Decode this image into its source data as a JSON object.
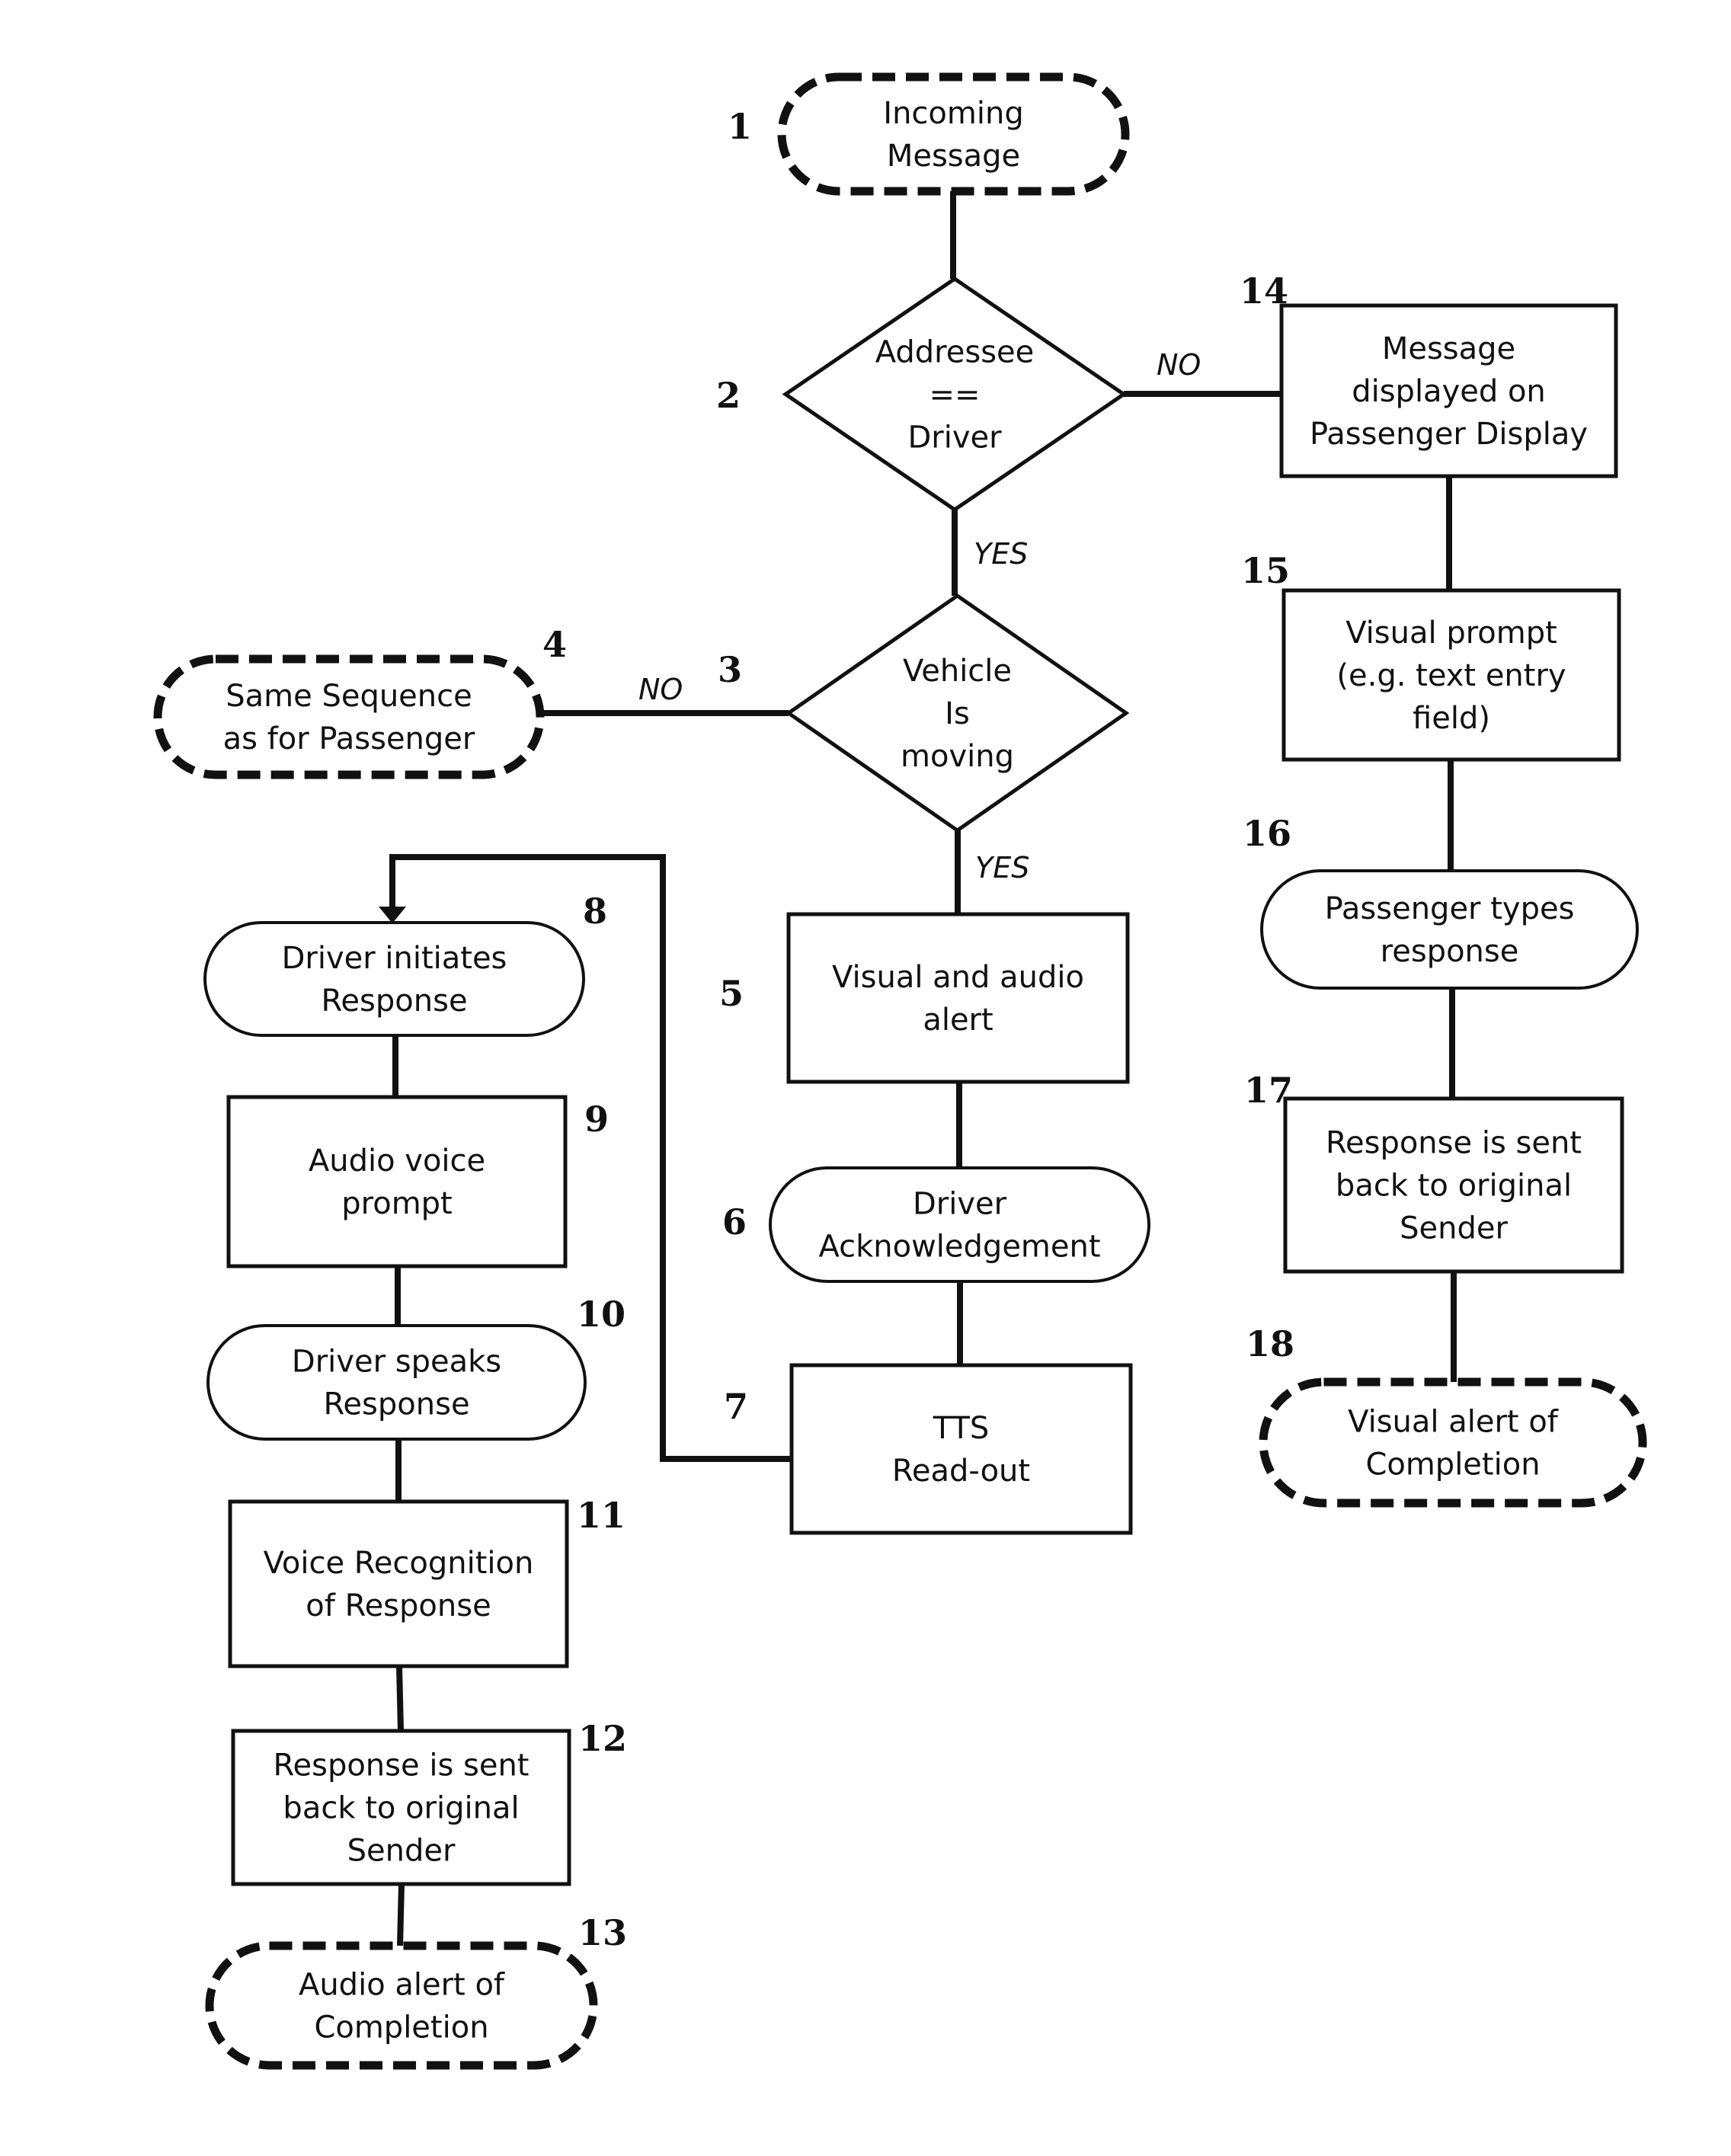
{
  "diagram": {
    "type": "flowchart",
    "nodes": [
      {
        "id": "1",
        "shape": "terminal-dashed",
        "lines": [
          "Incoming",
          "Message"
        ]
      },
      {
        "id": "2",
        "shape": "decision",
        "lines": [
          "Addressee",
          "==",
          "Driver"
        ]
      },
      {
        "id": "3",
        "shape": "decision",
        "lines": [
          "Vehicle",
          "Is",
          "moving"
        ]
      },
      {
        "id": "4",
        "shape": "terminal-dashed",
        "lines": [
          "Same Sequence",
          "as for Passenger"
        ]
      },
      {
        "id": "5",
        "shape": "process",
        "lines": [
          "Visual and audio",
          "alert"
        ]
      },
      {
        "id": "6",
        "shape": "terminal",
        "lines": [
          "Driver",
          "Acknowledgement"
        ]
      },
      {
        "id": "7",
        "shape": "process",
        "lines": [
          "TTS",
          "Read-out"
        ]
      },
      {
        "id": "8",
        "shape": "terminal",
        "lines": [
          "Driver initiates",
          "Response"
        ]
      },
      {
        "id": "9",
        "shape": "process",
        "lines": [
          "Audio voice",
          "prompt"
        ]
      },
      {
        "id": "10",
        "shape": "terminal",
        "lines": [
          "Driver speaks",
          "Response"
        ]
      },
      {
        "id": "11",
        "shape": "process",
        "lines": [
          "Voice Recognition",
          "of Response"
        ]
      },
      {
        "id": "12",
        "shape": "process",
        "lines": [
          "Response is sent",
          "back to original",
          "Sender"
        ]
      },
      {
        "id": "13",
        "shape": "terminal-dashed",
        "lines": [
          "Audio alert of",
          "Completion"
        ]
      },
      {
        "id": "14",
        "shape": "process",
        "lines": [
          "Message",
          "displayed on",
          "Passenger Display"
        ]
      },
      {
        "id": "15",
        "shape": "process",
        "lines": [
          "Visual prompt",
          "(e.g. text entry",
          "field)"
        ]
      },
      {
        "id": "16",
        "shape": "terminal",
        "lines": [
          "Passenger  types",
          "response"
        ]
      },
      {
        "id": "17",
        "shape": "process",
        "lines": [
          "Response is sent",
          "back to original",
          "Sender"
        ]
      },
      {
        "id": "18",
        "shape": "terminal-dashed",
        "lines": [
          "Visual alert of",
          "Completion"
        ]
      }
    ],
    "edges": [
      {
        "from": "1",
        "to": "2",
        "label": ""
      },
      {
        "from": "2",
        "to": "14",
        "label": "NO"
      },
      {
        "from": "2",
        "to": "3",
        "label": "YES"
      },
      {
        "from": "3",
        "to": "4",
        "label": "NO"
      },
      {
        "from": "3",
        "to": "5",
        "label": "YES"
      },
      {
        "from": "5",
        "to": "6",
        "label": ""
      },
      {
        "from": "6",
        "to": "7",
        "label": ""
      },
      {
        "from": "7",
        "to": "8",
        "label": "",
        "arrow": true
      },
      {
        "from": "8",
        "to": "9",
        "label": ""
      },
      {
        "from": "9",
        "to": "10",
        "label": ""
      },
      {
        "from": "10",
        "to": "11",
        "label": ""
      },
      {
        "from": "11",
        "to": "12",
        "label": ""
      },
      {
        "from": "12",
        "to": "13",
        "label": ""
      },
      {
        "from": "14",
        "to": "15",
        "label": ""
      },
      {
        "from": "15",
        "to": "16",
        "label": ""
      },
      {
        "from": "16",
        "to": "17",
        "label": ""
      },
      {
        "from": "17",
        "to": "18",
        "label": ""
      }
    ],
    "colors": {
      "stroke": "#111111",
      "background": "#ffffff",
      "text": "#111111"
    }
  }
}
